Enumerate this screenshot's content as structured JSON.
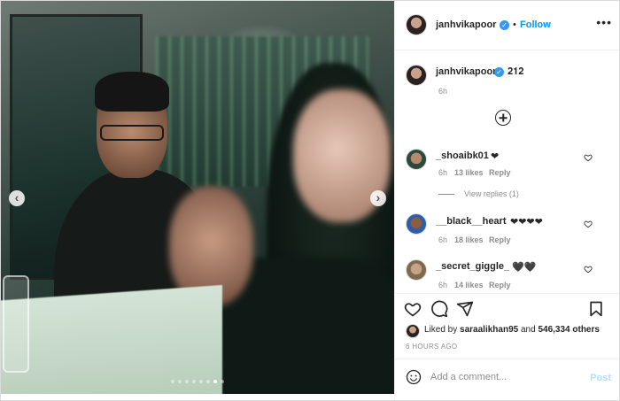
{
  "post": {
    "username": "janhvikapoor",
    "verified": true,
    "follow_label": "Follow",
    "more_label": "•••",
    "caption": "𝟐𝟏𝟐",
    "caption_time": "6h",
    "carousel": {
      "slides": 8,
      "active_index": 6
    },
    "comments": [
      {
        "username": "_shoaibk01",
        "text": "❤",
        "time": "6h",
        "likes": "13 likes",
        "reply": "Reply",
        "view_replies": "View replies (1)"
      },
      {
        "username": "__black__heart",
        "text": "❤❤❤❤",
        "time": "6h",
        "likes": "18 likes",
        "reply": "Reply"
      },
      {
        "username": "_secret_giggle_",
        "text": "🖤🖤",
        "time": "6h",
        "likes": "14 likes",
        "reply": "Reply"
      }
    ],
    "liked_by": {
      "prefix": "Liked by",
      "user": "saraalikhan95",
      "conjunction": "and",
      "others": "546,334 others"
    },
    "timestamp": "6 HOURS AGO",
    "comment_box": {
      "placeholder": "Add a comment...",
      "post_label": "Post"
    }
  },
  "icons": {
    "arrow_left": "‹",
    "arrow_right": "›",
    "verified": "✓"
  },
  "colors": {
    "link_blue": "#0095f6",
    "verified_blue": "#3897f0",
    "post_disabled": "#b2dffc",
    "muted": "#8e8e8e"
  }
}
